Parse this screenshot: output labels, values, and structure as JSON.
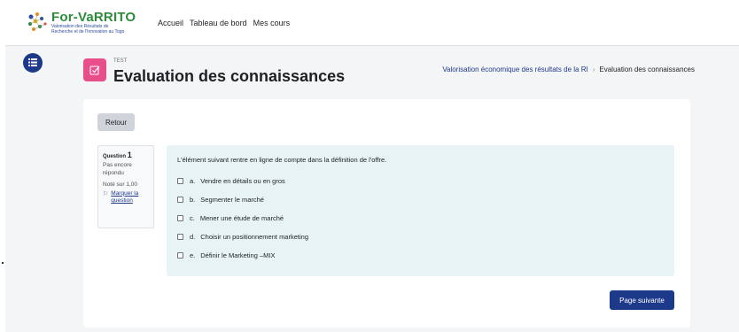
{
  "brand": {
    "name": "For-VaRRITO",
    "subtitle_line1": "Valorisation des Résultats de",
    "subtitle_line2": "Recherche et de l'Innovation au Togo"
  },
  "nav": {
    "links": [
      "Accueil",
      "Tableau de bord",
      "Mes cours"
    ]
  },
  "header": {
    "activity_type": "TEST",
    "title": "Evaluation des connaissances",
    "breadcrumb": [
      "Valorisation économique des résultats de la RI",
      "Evaluation des connaissances"
    ]
  },
  "card": {
    "back_label": "Retour",
    "next_label": "Page suivante"
  },
  "question_info": {
    "label": "Question",
    "number": "1",
    "state": "Pas encore répondu",
    "grade": "Noté sur 1,00",
    "flag_label": "Marquer la question"
  },
  "question": {
    "text": "L'élément suivant rentre en ligne de compte dans la définition de l'offre.",
    "answers": [
      {
        "letter": "a.",
        "text": "Vendre en détails ou en gros"
      },
      {
        "letter": "b.",
        "text": "Segmenter le marché"
      },
      {
        "letter": "c.",
        "text": "Mener une étude de marché"
      },
      {
        "letter": "d.",
        "text": "Choisir un positionnement marketing"
      },
      {
        "letter": "e.",
        "text": "Définir le Marketing –MIX"
      }
    ]
  },
  "icons": {
    "drawer": "menu-list-icon",
    "activity": "checkbox-square-icon",
    "flag": "flag-icon",
    "breadcrumb_separator": "chevron-right-icon"
  },
  "colors": {
    "primary": "#1d3a8a",
    "activity_icon": "#e84e8a",
    "question_bg": "#e7f3f5",
    "brand_green": "#2e8b3e",
    "brand_orange": "#f08a24"
  }
}
